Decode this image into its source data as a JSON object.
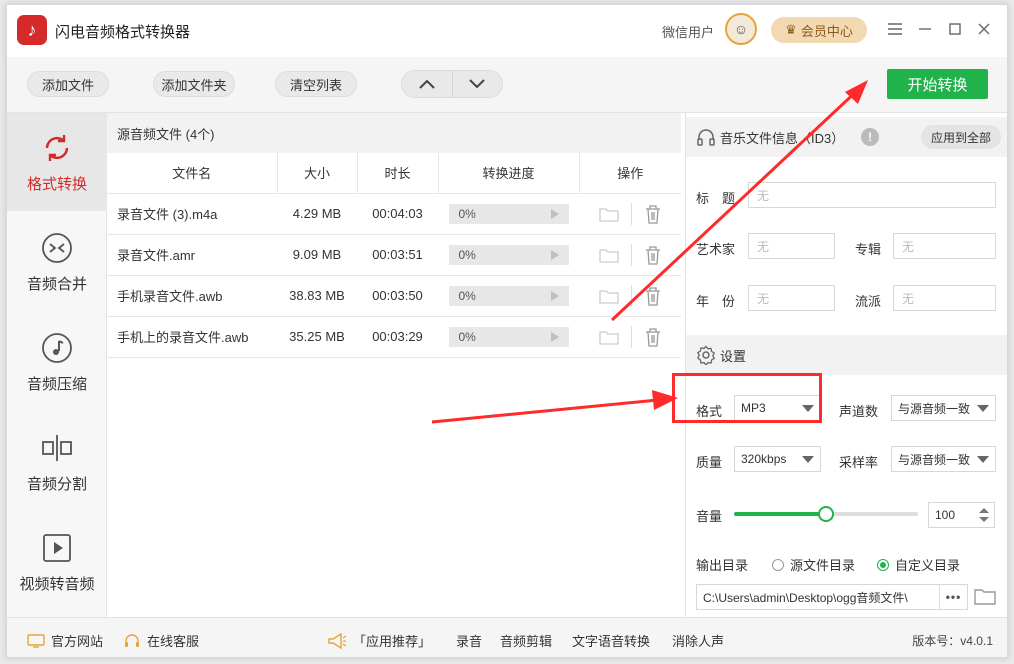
{
  "app": {
    "title": "闪电音频格式转换器",
    "user_label": "微信用户",
    "vip_label": "会员中心"
  },
  "toolbar": {
    "add_file": "添加文件",
    "add_folder": "添加文件夹",
    "clear_list": "清空列表",
    "start_convert": "开始转换"
  },
  "sidebar": {
    "items": [
      {
        "label": "格式转换",
        "icon": "refresh-icon",
        "active": true
      },
      {
        "label": "音频合并",
        "icon": "merge-icon",
        "active": false
      },
      {
        "label": "音频压缩",
        "icon": "music-note-icon",
        "active": false
      },
      {
        "label": "音频分割",
        "icon": "split-icon",
        "active": false
      },
      {
        "label": "视频转音频",
        "icon": "video-play-icon",
        "active": false
      }
    ]
  },
  "filelist": {
    "header": "源音频文件 (4个)",
    "columns": [
      "文件名",
      "大小",
      "时长",
      "转换进度",
      "操作"
    ],
    "rows": [
      {
        "name": "录音文件 (3).m4a",
        "size": "4.29 MB",
        "duration": "00:04:03",
        "progress": "0%"
      },
      {
        "name": "录音文件.amr",
        "size": "9.09 MB",
        "duration": "00:03:51",
        "progress": "0%"
      },
      {
        "name": "手机录音文件.awb",
        "size": "38.83 MB",
        "duration": "00:03:50",
        "progress": "0%"
      },
      {
        "name": "手机上的录音文件.awb",
        "size": "35.25 MB",
        "duration": "00:03:29",
        "progress": "0%"
      }
    ]
  },
  "music_info": {
    "header": "音乐文件信息（ID3）",
    "apply_all": "应用到全部",
    "title_label": "标　题",
    "artist_label": "艺术家",
    "album_label": "专辑",
    "year_label": "年　份",
    "genre_label": "流派",
    "empty_value": "无"
  },
  "settings": {
    "header": "设置",
    "format_label": "格式",
    "format_value": "MP3",
    "channels_label": "声道数",
    "channels_value": "与源音频一致",
    "quality_label": "质量",
    "quality_value": "320kbps",
    "samplerate_label": "采样率",
    "samplerate_value": "与源音频一致",
    "volume_label": "音量",
    "volume_value": "100",
    "volume_level": 0.5,
    "output_label": "输出目录",
    "output_opt_source": "源文件目录",
    "output_opt_custom": "自定义目录",
    "output_path": "C:\\Users\\admin\\Desktop\\ogg音频文件\\",
    "more": "•••"
  },
  "statusbar": {
    "website": "官方网站",
    "support": "在线客服",
    "recommend": "「应用推荐」",
    "record": "录音",
    "audio_edit": "音频剪辑",
    "tts": "文字语音转换",
    "vocal_remove": "消除人声",
    "version": "版本号：v4.0.1"
  },
  "colors": {
    "accent_green": "#20b24b",
    "active_red": "#d42a2a",
    "annotation_red": "#ff2a2a",
    "vip_gold": "#f3d9b2"
  }
}
